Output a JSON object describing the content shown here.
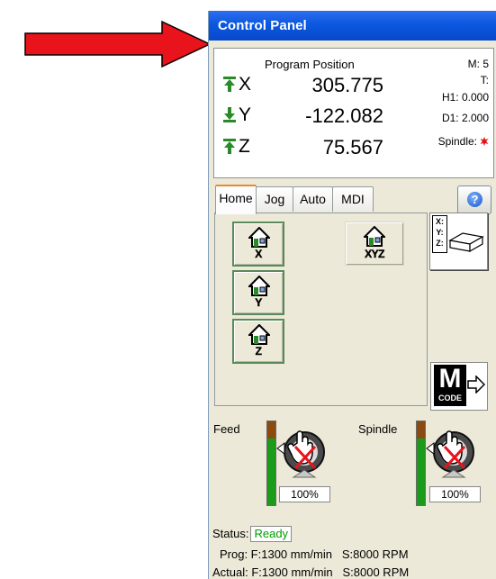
{
  "window": {
    "title": "Control Panel"
  },
  "dro": {
    "header": "Program Position",
    "axes": [
      {
        "axis": "X",
        "value": "305.775",
        "direction": "up"
      },
      {
        "axis": "Y",
        "value": "-122.082",
        "direction": "down"
      },
      {
        "axis": "Z",
        "value": "75.567",
        "direction": "up"
      }
    ],
    "info": {
      "m": "M: 5",
      "t": "T:",
      "h1": "H1: 0.000",
      "d1": "D1: 2.000",
      "spindle": "Spindle:"
    }
  },
  "tabs": [
    {
      "label": "Home",
      "active": true
    },
    {
      "label": "Jog",
      "active": false
    },
    {
      "label": "Auto",
      "active": false
    },
    {
      "label": "MDI",
      "active": false
    }
  ],
  "home": {
    "buttons": [
      {
        "axis": "X",
        "icon": "home-icon"
      },
      {
        "axis": "Y",
        "icon": "home-icon"
      },
      {
        "axis": "Z",
        "icon": "home-icon"
      },
      {
        "axis": "XYZ",
        "icon": "home-icon"
      }
    ],
    "xyz_panel_labels": [
      "X:",
      "Y:",
      "Z:"
    ],
    "mcode": {
      "big": "M",
      "small": "CODE"
    }
  },
  "feed": {
    "label": "Feed",
    "percent": "100%",
    "level": 0.8
  },
  "spindle": {
    "label": "Spindle",
    "percent": "100%",
    "level": 0.8
  },
  "status": {
    "label": "Status:",
    "value": "Ready",
    "prog": "Prog: F:1300 mm/min   S:8000 RPM",
    "actual": "Actual: F:1300 mm/min   S:8000 RPM"
  },
  "colors": {
    "title_bar": "#0b58df",
    "arrow": "#e8131b",
    "ready_text": "#00a000",
    "active_tab_accent": "#e68b2c",
    "up_arrow": "#2a8a2a",
    "feed_bar": "#1a9c1a"
  }
}
